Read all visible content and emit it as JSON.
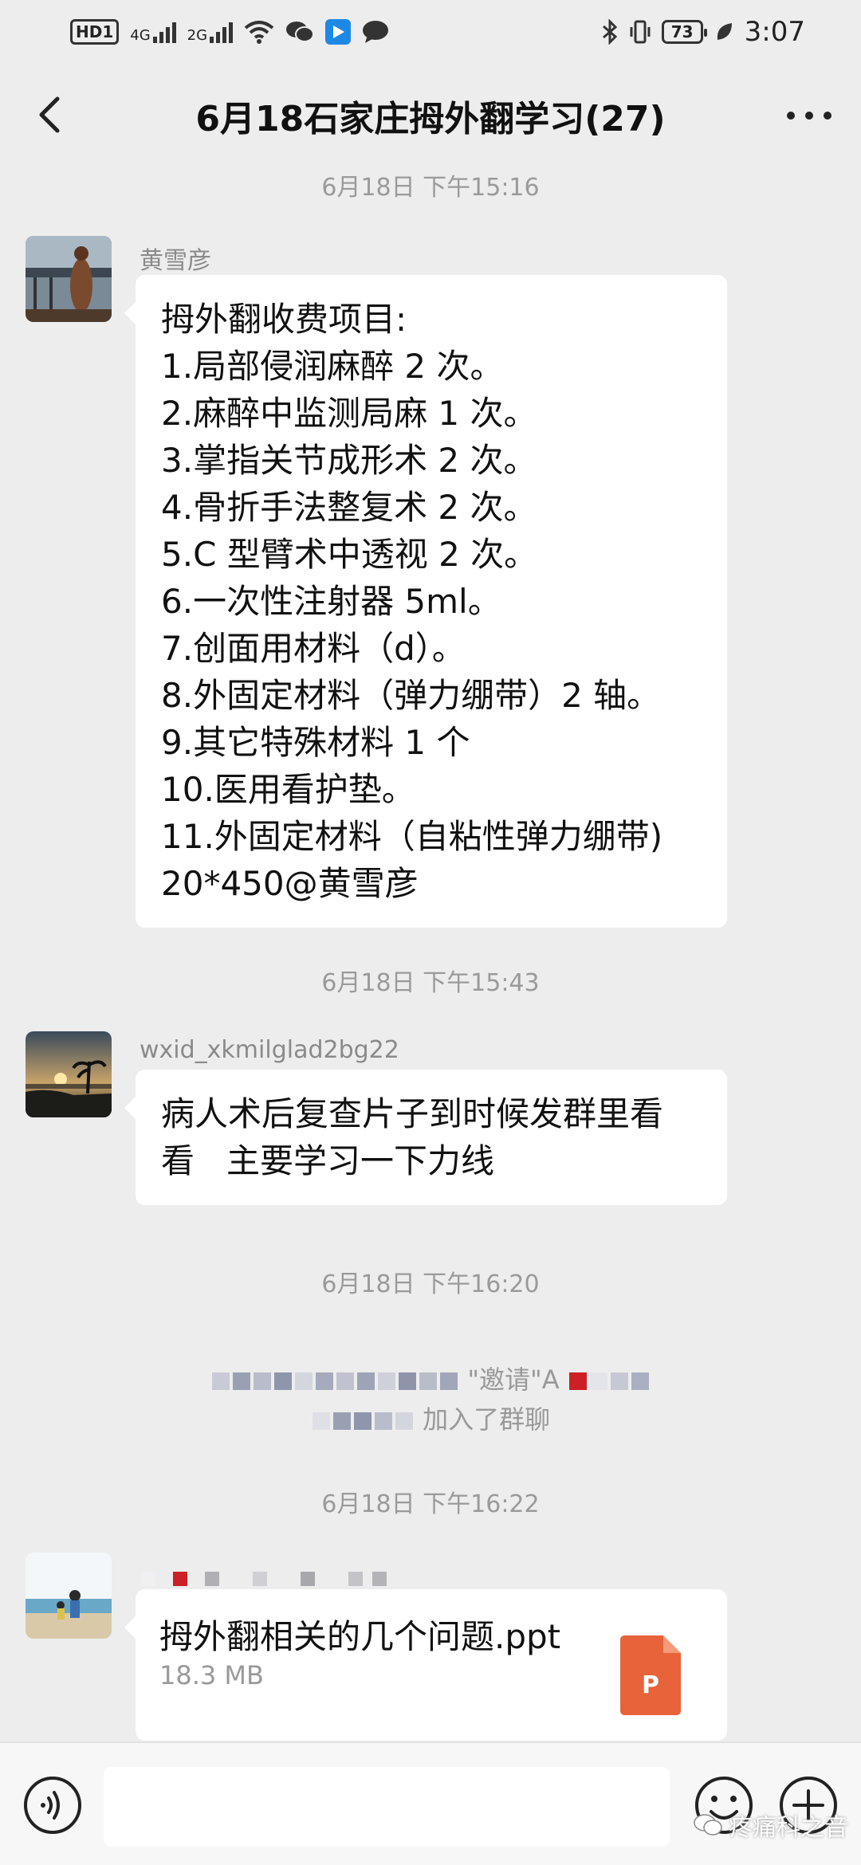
{
  "status_bar": {
    "left_chip": "HD1",
    "signal1_label": "4G",
    "signal2_label": "2G",
    "battery": "73",
    "time": "3:07"
  },
  "header": {
    "title": "6月18石家庄拇外翻学习(27)"
  },
  "messages": [
    {
      "timestamp": "6月18日 下午15:16",
      "sender": "黄雪彦",
      "lines": [
        "拇外翻收费项目:",
        "1.局部侵润麻醉 2 次。",
        "2.麻醉中监测局麻 1 次。",
        "3.掌指关节成形术 2 次。",
        "4.骨折手法整复术 2 次。",
        "5.C 型臂术中透视 2 次。",
        "6.一次性注射器 5ml。",
        "7.创面用材料（d）。",
        "8.外固定材料（弹力绷带）2 轴。",
        "9.其它特殊材料 1 个",
        "10.医用看护垫。",
        "11.外固定材料（自粘性弹力绷带)",
        "20*450@黄雪彦"
      ]
    },
    {
      "timestamp": "6月18日 下午15:43",
      "sender": "wxid_xkmilglad2bg22",
      "lines": [
        "病人术后复查片子到时候发群里看",
        "看   主要学习一下力线"
      ]
    }
  ],
  "system": {
    "timestamp": "6月18日 下午16:20",
    "line1_text": "\"邀请\"A",
    "line2_text": "加入了群聊"
  },
  "file_message": {
    "timestamp": "6月18日 下午16:22",
    "file_name": "拇外翻相关的几个问题.ppt",
    "file_size": "18.3 MB",
    "file_badge": "P"
  },
  "input": {
    "placeholder": ""
  },
  "watermark": "疼痛科之音",
  "icons": [
    "back-arrow-icon",
    "more-dots-icon",
    "voice-icon",
    "emoji-icon",
    "plus-icon",
    "ppt-file-icon"
  ],
  "colors": {
    "background": "#ededed",
    "bubble": "#ffffff",
    "ppt": "#e8623a",
    "timestamp": "#9a9a9a"
  }
}
